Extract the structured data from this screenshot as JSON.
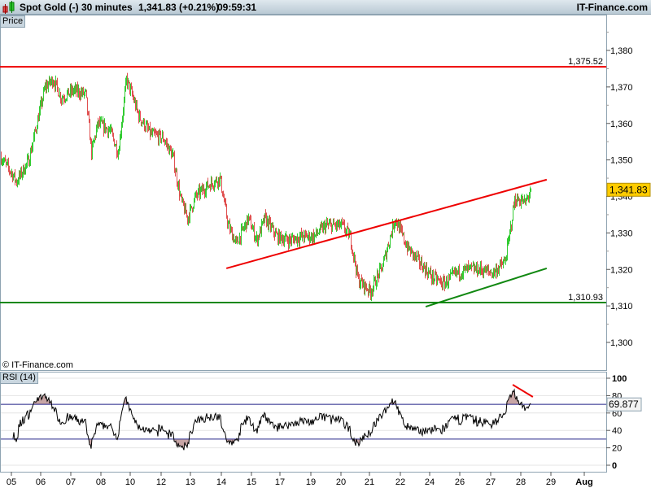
{
  "header": {
    "instrument": "Spot Gold (-)",
    "timeframe": "30 minutes",
    "last": "1,341.83 (+0.21%)",
    "time": "09:59:31",
    "brand": "IT-Finance.com"
  },
  "panels": {
    "price_label": "Price",
    "rsi_label": "RSI (14)",
    "copyright": "© IT-Finance.com"
  },
  "colors": {
    "up": "#33cc33",
    "down": "#e05050",
    "resistance": "#ee0000",
    "support": "#118811"
  },
  "chart_data": {
    "type": "candlestick",
    "title": "Spot Gold (-) 30 minutes",
    "x_tick_labels": [
      "05",
      "06",
      "07",
      "08",
      "10",
      "12",
      "13",
      "14",
      "15",
      "17",
      "19",
      "20",
      "21",
      "22",
      "24",
      "26",
      "27",
      "28",
      "29",
      "Aug"
    ],
    "price_axis": {
      "ylim": [
        1293,
        1392
      ],
      "ticks": [
        "1,300",
        "1,310",
        "1,320",
        "1,330",
        "1,340",
        "1,350",
        "1,360",
        "1,370",
        "1,380"
      ]
    },
    "rsi_axis": {
      "ylim": [
        -8,
        106
      ],
      "ticks": [
        "0",
        "20",
        "40",
        "60",
        "80",
        "100"
      ],
      "levels": [
        30,
        70
      ]
    },
    "price_path_day_price": [
      [
        -0.38,
        1351
      ],
      [
        0.03,
        1346
      ],
      [
        0.16,
        1344
      ],
      [
        0.57,
        1350
      ],
      [
        0.84,
        1360
      ],
      [
        1.11,
        1370
      ],
      [
        1.38,
        1372
      ],
      [
        1.65,
        1367
      ],
      [
        2.05,
        1369
      ],
      [
        2.46,
        1368
      ],
      [
        2.65,
        1352
      ],
      [
        2.86,
        1360
      ],
      [
        3.27,
        1358
      ],
      [
        3.54,
        1352
      ],
      [
        3.81,
        1372
      ],
      [
        3.95,
        1369
      ],
      [
        4.22,
        1362
      ],
      [
        4.62,
        1357
      ],
      [
        5.03,
        1356
      ],
      [
        5.35,
        1351
      ],
      [
        5.62,
        1339
      ],
      [
        5.84,
        1334
      ],
      [
        6.11,
        1340
      ],
      [
        6.51,
        1343
      ],
      [
        6.92,
        1345
      ],
      [
        7.19,
        1332
      ],
      [
        7.46,
        1327
      ],
      [
        7.86,
        1334
      ],
      [
        8.14,
        1328
      ],
      [
        8.41,
        1334
      ],
      [
        8.81,
        1329
      ],
      [
        9.22,
        1328
      ],
      [
        9.62,
        1329
      ],
      [
        10.03,
        1329
      ],
      [
        10.43,
        1332
      ],
      [
        10.97,
        1332
      ],
      [
        11.24,
        1329
      ],
      [
        11.51,
        1317
      ],
      [
        11.92,
        1314
      ],
      [
        12.32,
        1321
      ],
      [
        12.73,
        1334
      ],
      [
        13.14,
        1326
      ],
      [
        13.54,
        1322
      ],
      [
        13.95,
        1318
      ],
      [
        14.35,
        1316
      ],
      [
        14.76,
        1319
      ],
      [
        15.16,
        1320
      ],
      [
        15.57,
        1320
      ],
      [
        15.97,
        1319
      ],
      [
        16.38,
        1322
      ],
      [
        16.51,
        1328
      ],
      [
        16.7,
        1339
      ],
      [
        16.92,
        1339
      ],
      [
        17.05,
        1338
      ],
      [
        17.24,
        1341.83
      ]
    ],
    "horizontal_levels": [
      {
        "price": 1375.52,
        "label": "1,375.52",
        "color": "#ee0000"
      },
      {
        "price": 1310.93,
        "label": "1,310.93",
        "color": "#118811"
      }
    ],
    "trendlines": [
      {
        "from": [
          7.14,
          1320.3
        ],
        "to": [
          17.78,
          1344.6
        ],
        "color": "#ee0000"
      },
      {
        "from": [
          13.76,
          1309.8
        ],
        "to": [
          17.78,
          1320.3
        ],
        "color": "#118811"
      }
    ],
    "rsi_trendline": {
      "from": [
        16.65,
        92.5
      ],
      "to": [
        17.32,
        78.5
      ],
      "color": "#ee0000"
    },
    "last_price": "1,341.83",
    "last_rsi": "69.877"
  }
}
